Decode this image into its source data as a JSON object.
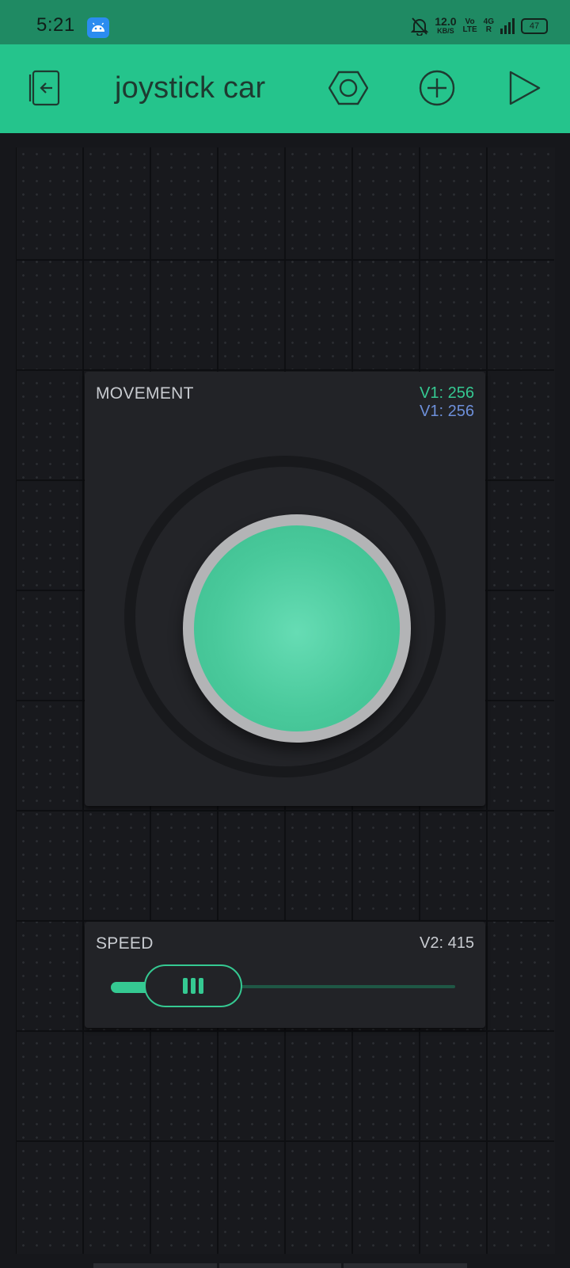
{
  "status_bar": {
    "time": "5:21",
    "net_speed": "12.0",
    "net_speed_unit": "KB/S",
    "volte_top": "Vo",
    "volte_bottom": "LTE",
    "network_top": "4G",
    "network_bottom": "R",
    "battery": "47",
    "notification_icon": "android-icon",
    "silent_icon": "bell-off-icon",
    "signal_icon": "signal-icon"
  },
  "toolbar": {
    "title": "joystick car",
    "exit_icon": "exit-icon",
    "settings_icon": "hexagon-settings-icon",
    "add_icon": "plus-circle-icon",
    "play_icon": "play-icon",
    "accent": "#25c48c"
  },
  "joystick": {
    "title": "MOVEMENT",
    "x_pin_label": "V1: 256",
    "y_pin_label": "V1: 256",
    "x_color": "#35c992",
    "y_color": "#6d8fd9",
    "knob_color": "#49c99b"
  },
  "slider": {
    "title": "SPEED",
    "value_label": "V2: 415",
    "value_fraction": 0.24,
    "color": "#35c992"
  }
}
